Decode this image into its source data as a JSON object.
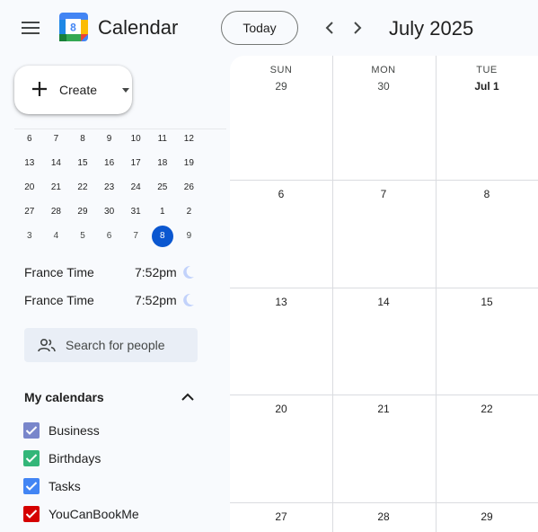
{
  "app": {
    "title": "Calendar",
    "logo_number": "8"
  },
  "toolbar": {
    "today_label": "Today",
    "month_title": "July 2025"
  },
  "create": {
    "label": "Create"
  },
  "mini_calendar": {
    "weeks": [
      [
        {
          "d": "6"
        },
        {
          "d": "7"
        },
        {
          "d": "8"
        },
        {
          "d": "9"
        },
        {
          "d": "10"
        },
        {
          "d": "11"
        },
        {
          "d": "12"
        }
      ],
      [
        {
          "d": "13"
        },
        {
          "d": "14"
        },
        {
          "d": "15"
        },
        {
          "d": "16"
        },
        {
          "d": "17"
        },
        {
          "d": "18"
        },
        {
          "d": "19"
        }
      ],
      [
        {
          "d": "20"
        },
        {
          "d": "21"
        },
        {
          "d": "22"
        },
        {
          "d": "23"
        },
        {
          "d": "24"
        },
        {
          "d": "25"
        },
        {
          "d": "26"
        }
      ],
      [
        {
          "d": "27"
        },
        {
          "d": "28"
        },
        {
          "d": "29"
        },
        {
          "d": "30"
        },
        {
          "d": "31"
        },
        {
          "d": "1"
        },
        {
          "d": "2"
        }
      ],
      [
        {
          "d": "3",
          "muted": true
        },
        {
          "d": "4",
          "muted": true
        },
        {
          "d": "5",
          "muted": true
        },
        {
          "d": "6",
          "muted": true
        },
        {
          "d": "7",
          "muted": true
        },
        {
          "d": "8",
          "today": true
        },
        {
          "d": "9",
          "muted": true
        }
      ]
    ]
  },
  "time_zones": [
    {
      "name": "France Time",
      "time": "7:52pm"
    },
    {
      "name": "France Time",
      "time": "7:52pm"
    }
  ],
  "search_people": {
    "placeholder": "Search for people"
  },
  "my_calendars": {
    "heading": "My calendars",
    "items": [
      {
        "label": "Business",
        "color": "#7986cb"
      },
      {
        "label": "Birthdays",
        "color": "#33b679"
      },
      {
        "label": "Tasks",
        "color": "#4285f4"
      },
      {
        "label": "YouCanBookMe",
        "color": "#d50000"
      }
    ]
  },
  "grid": {
    "day_headers": [
      "SUN",
      "MON",
      "TUE"
    ],
    "weeks": [
      [
        "29",
        "30",
        "Jul 1"
      ],
      [
        "6",
        "7",
        "8"
      ],
      [
        "13",
        "14",
        "15"
      ],
      [
        "20",
        "21",
        "22"
      ],
      [
        "27",
        "28",
        "29"
      ]
    ]
  },
  "colors": {
    "accent": "#0b57d0",
    "background": "#f8fafd"
  }
}
